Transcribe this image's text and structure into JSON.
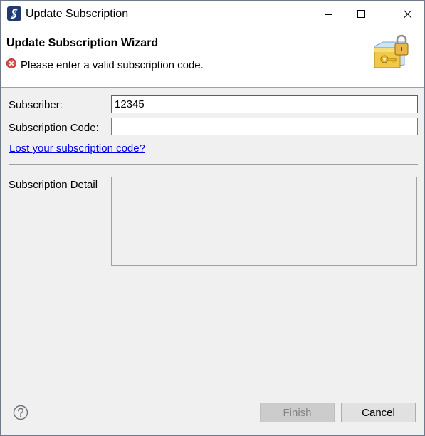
{
  "window": {
    "title": "Update Subscription"
  },
  "header": {
    "wizard_title": "Update Subscription Wizard",
    "error_message": "Please enter a valid subscription code."
  },
  "form": {
    "subscriber_label": "Subscriber:",
    "subscriber_value": "12345",
    "code_label": "Subscription Code:",
    "code_value": "",
    "lost_code_link": "Lost your subscription code?",
    "detail_label": "Subscription Detail"
  },
  "buttons": {
    "finish": "Finish",
    "cancel": "Cancel",
    "finish_enabled": false
  },
  "colors": {
    "link": "#0000ee",
    "focus_border": "#0078d7",
    "error_icon": "#d9534f",
    "app_icon": "#1f3a6b"
  }
}
